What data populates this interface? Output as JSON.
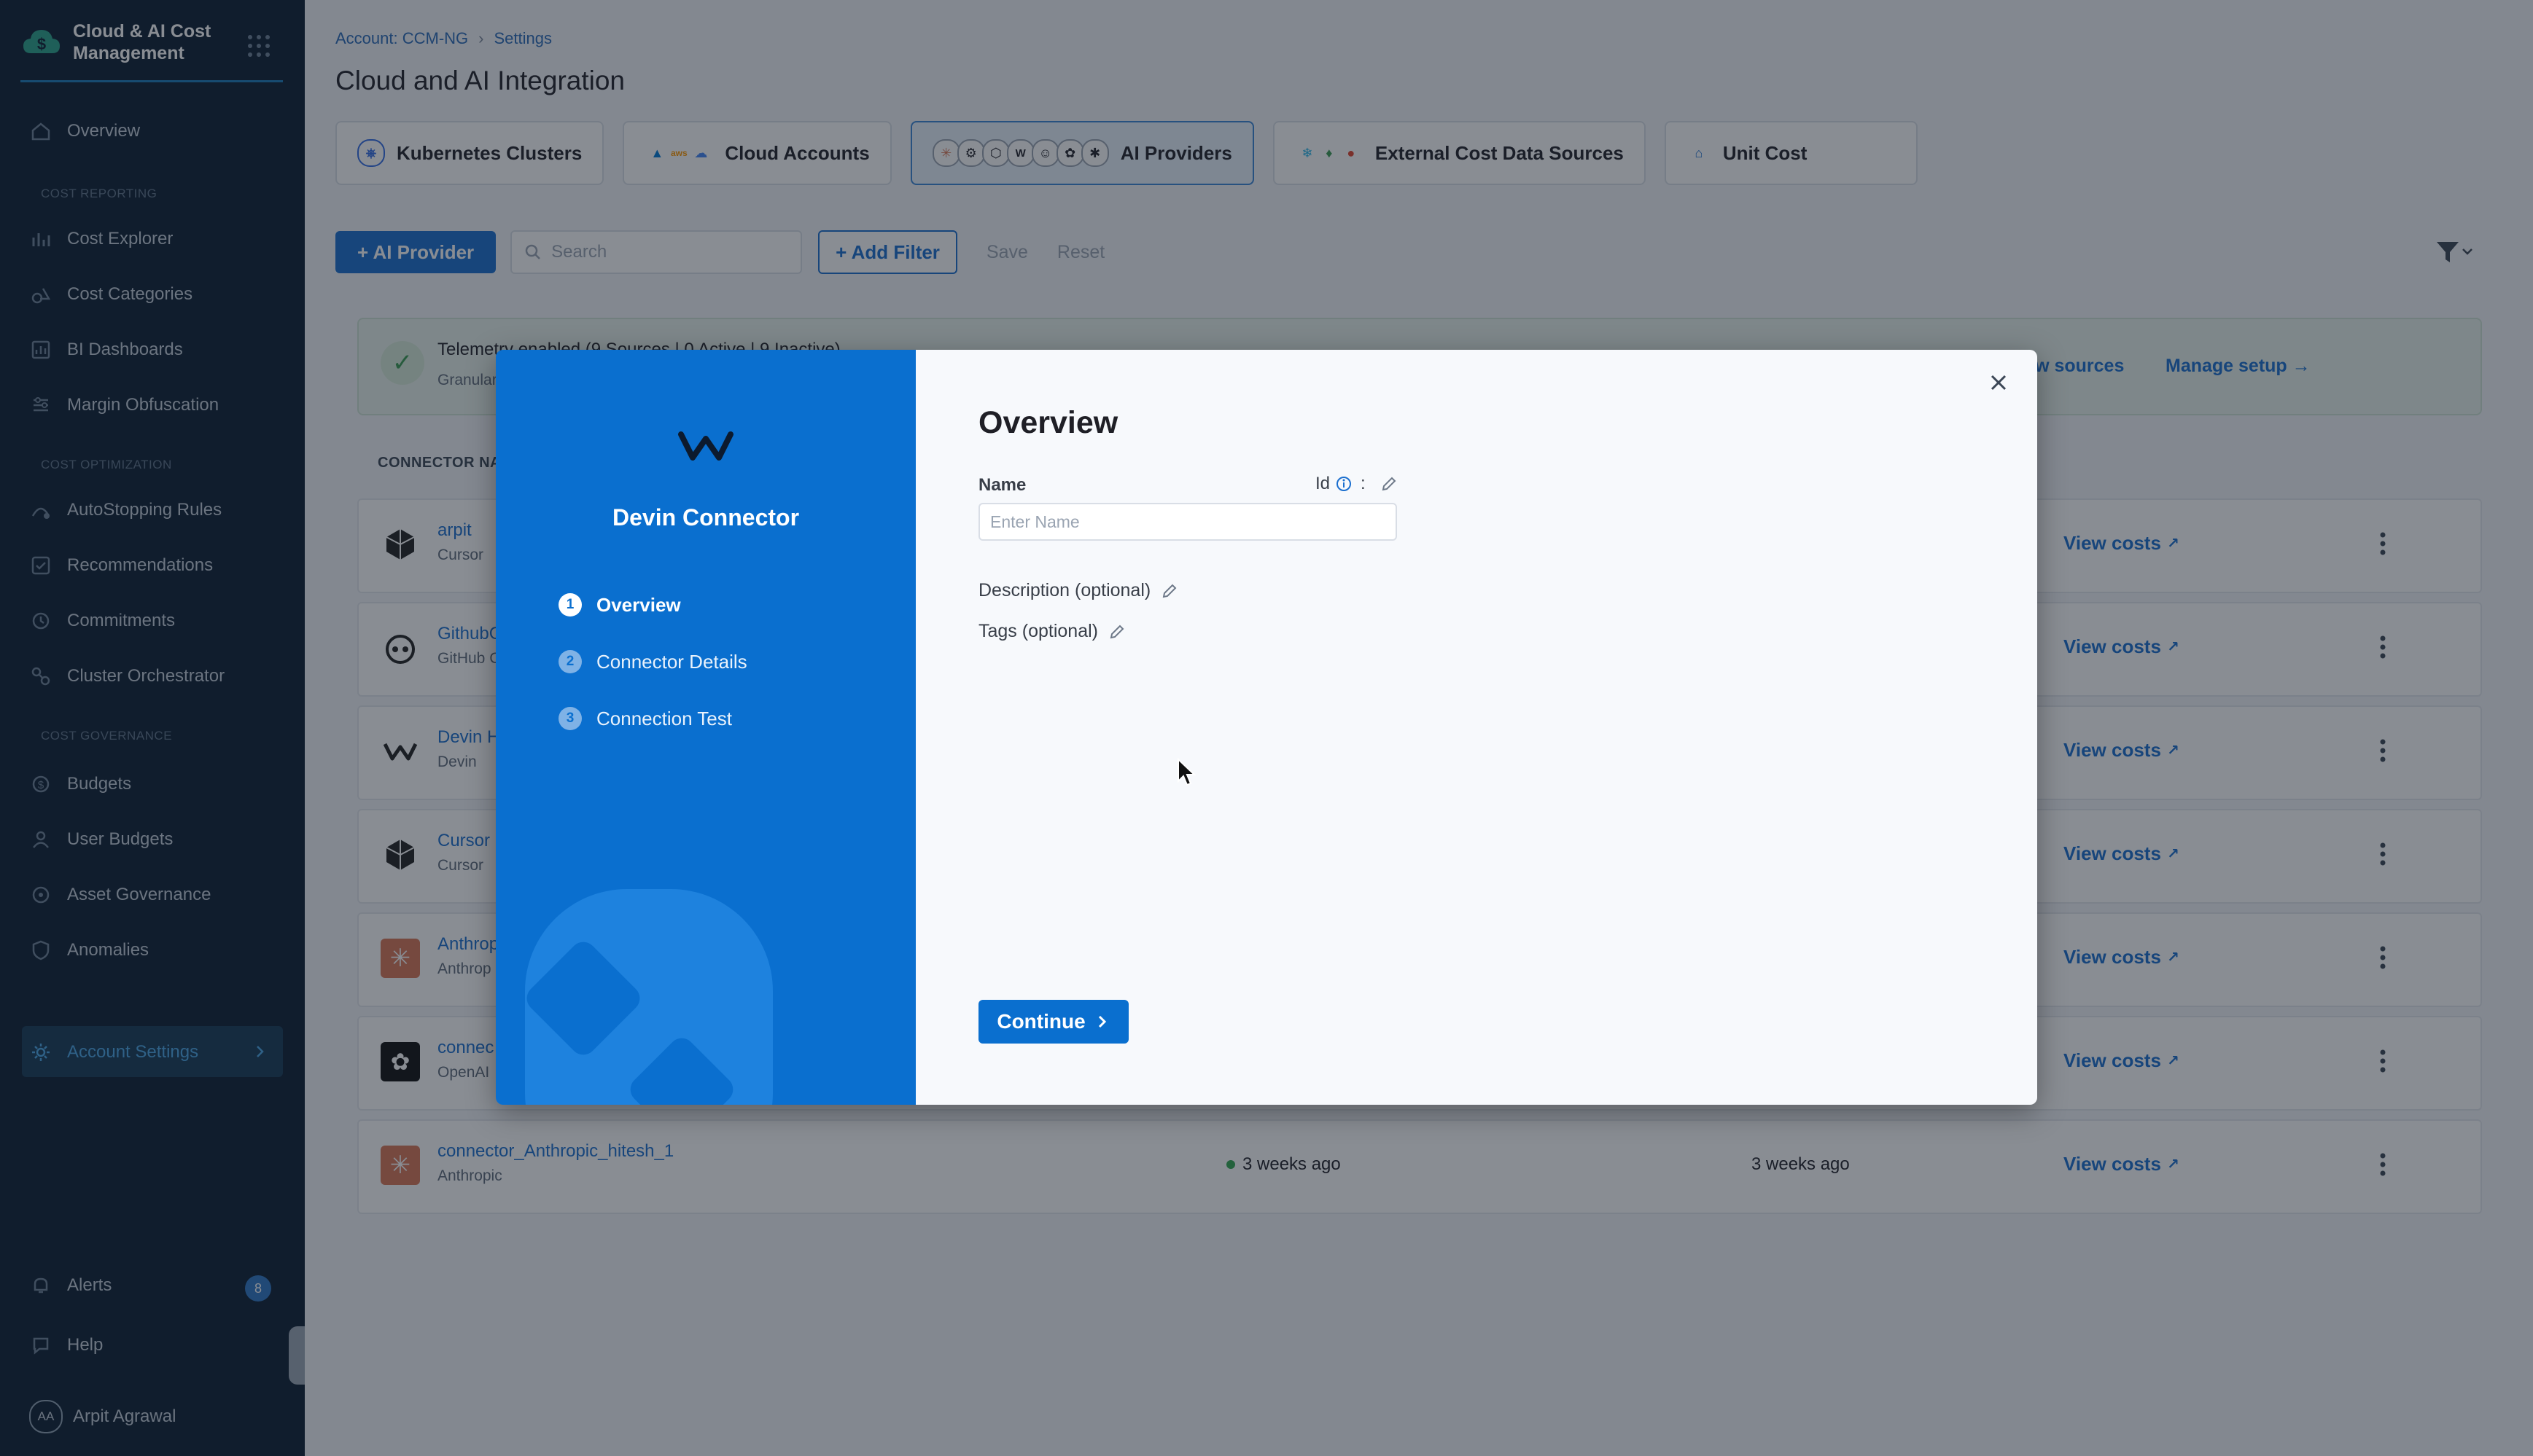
{
  "sidebar": {
    "brand": "Cloud & AI Cost Management",
    "overview": "Overview",
    "sections": {
      "reporting": "COST REPORTING",
      "optimization": "COST OPTIMIZATION",
      "governance": "COST GOVERNANCE"
    },
    "reporting_items": [
      "Cost Explorer",
      "Cost Categories",
      "BI Dashboards",
      "Margin Obfuscation"
    ],
    "optimization_items": [
      "AutoStopping Rules",
      "Recommendations",
      "Commitments",
      "Cluster Orchestrator"
    ],
    "governance_items": [
      "Budgets",
      "User Budgets",
      "Asset Governance",
      "Anomalies"
    ],
    "account_settings": "Account Settings",
    "alerts": "Alerts",
    "alerts_count": "8",
    "help": "Help",
    "user_initials": "AA",
    "user_name": "Arpit Agrawal"
  },
  "main": {
    "breadcrumb": [
      "Account: CCM-NG",
      "Settings"
    ],
    "title": "Cloud and AI Integration",
    "tabs": [
      {
        "label": "Kubernetes Clusters"
      },
      {
        "label": "Cloud Accounts"
      },
      {
        "label": "AI Providers"
      },
      {
        "label": "External Cost Data Sources"
      },
      {
        "label": "Unit Cost"
      }
    ],
    "toolbar": {
      "add_provider": "+ AI Provider",
      "search_placeholder": "Search",
      "add_filter": "+ Add Filter",
      "save": "Save",
      "reset": "Reset"
    },
    "telemetry": {
      "title": "Telemetry enabled (9 Sources | 0 Active | 9 Inactive)",
      "subtitle": "Granular",
      "view_sources": "View sources",
      "manage_setup": "Manage setup"
    },
    "table": {
      "header_connector": "CONNECTOR NA",
      "rows": [
        {
          "name": "arpit",
          "type": "Cursor",
          "status": "",
          "last": "",
          "view": "View costs"
        },
        {
          "name": "GithubC",
          "type": "GitHub C",
          "status": "",
          "last": "",
          "view": "View costs"
        },
        {
          "name": "Devin H",
          "type": "Devin",
          "status": "",
          "last": "",
          "view": "View costs"
        },
        {
          "name": "Cursor I",
          "type": "Cursor",
          "status": "",
          "last": "",
          "view": "View costs"
        },
        {
          "name": "Anthrop",
          "type": "Anthrop",
          "status": "",
          "last": "",
          "view": "View costs"
        },
        {
          "name": "connec",
          "type": "OpenAI",
          "status": "",
          "last": "",
          "view": "View costs"
        },
        {
          "name": "connector_Anthropic_hitesh_1",
          "type": "Anthropic",
          "status": "3 weeks ago",
          "last": "3 weeks ago",
          "view": "View costs"
        }
      ]
    }
  },
  "modal": {
    "connector_title": "Devin Connector",
    "steps": [
      {
        "num": "1",
        "label": "Overview"
      },
      {
        "num": "2",
        "label": "Connector Details"
      },
      {
        "num": "3",
        "label": "Connection Test"
      }
    ],
    "heading": "Overview",
    "name_label": "Name",
    "id_label": "Id",
    "id_sep": ":",
    "name_placeholder": "Enter Name",
    "description_label": "Description (optional)",
    "tags_label": "Tags (optional)",
    "continue_label": "Continue"
  },
  "colors": {
    "sidebar_bg": "#0c1f33",
    "accent": "#1b6fcf",
    "modal_left_bg": "#0a6fcf",
    "status_green": "#34a853"
  }
}
